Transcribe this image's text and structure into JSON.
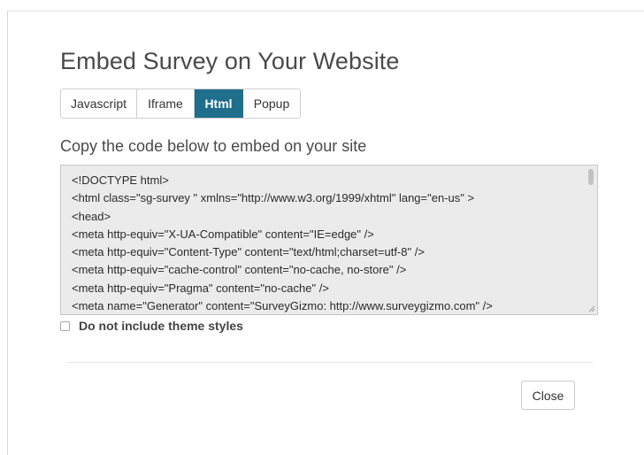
{
  "modal": {
    "title": "Embed Survey on Your Website"
  },
  "tabs": [
    {
      "label": "Javascript",
      "active": false
    },
    {
      "label": "Iframe",
      "active": false
    },
    {
      "label": "Html",
      "active": true
    },
    {
      "label": "Popup",
      "active": false
    }
  ],
  "instructions": "Copy the code below to embed on your site",
  "code": {
    "lines": [
      "<!DOCTYPE html>",
      "<html class=\"sg-survey \" xmlns=\"http://www.w3.org/1999/xhtml\" lang=\"en-us\" >",
      "<head>",
      "<meta http-equiv=\"X-UA-Compatible\" content=\"IE=edge\" />",
      "<meta http-equiv=\"Content-Type\" content=\"text/html;charset=utf-8\" />",
      "<meta http-equiv=\"cache-control\" content=\"no-cache, no-store\" />",
      "<meta http-equiv=\"Pragma\" content=\"no-cache\" />",
      "<meta name=\"Generator\" content=\"SurveyGizmo: http://www.surveygizmo.com\" />"
    ]
  },
  "options": {
    "exclude_theme_label": "Do not include theme styles",
    "exclude_theme_checked": false
  },
  "footer": {
    "close_label": "Close"
  },
  "colors": {
    "active_tab": "#1f6e8c",
    "code_background": "#ebebeb"
  }
}
